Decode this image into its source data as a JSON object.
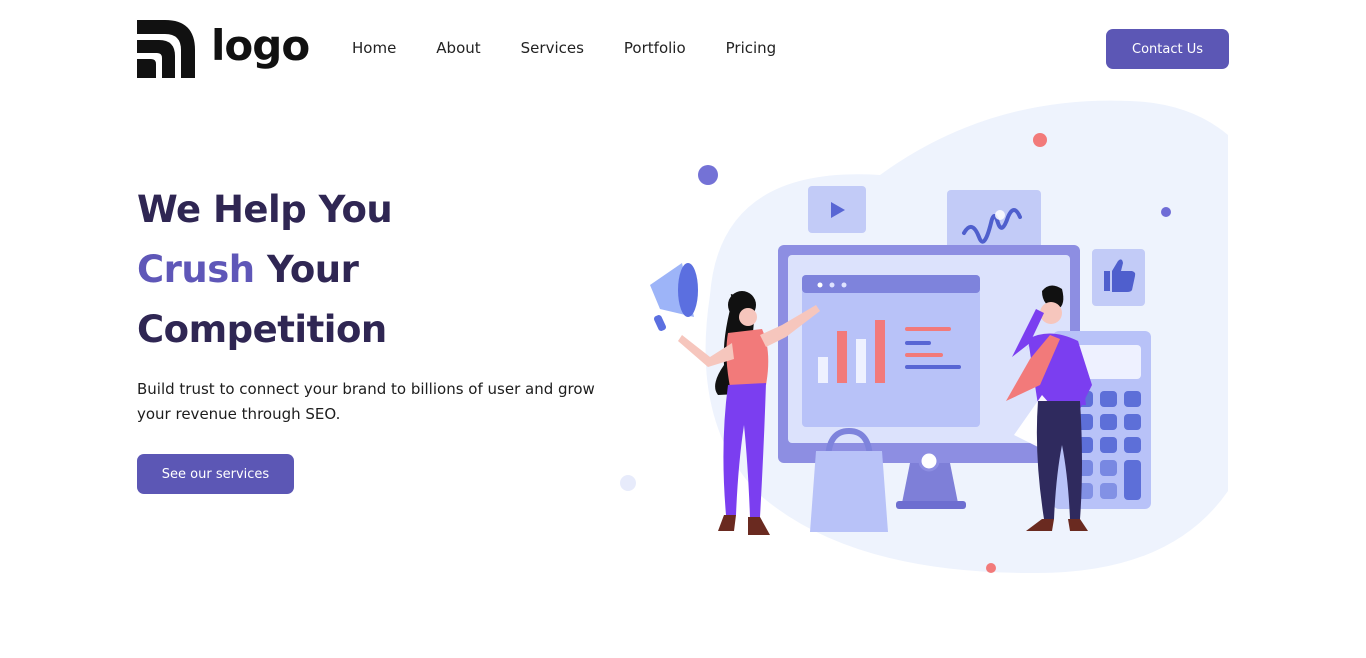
{
  "brand": {
    "logo_text": "logo"
  },
  "nav": {
    "items": [
      {
        "label": "Home"
      },
      {
        "label": "About"
      },
      {
        "label": "Services"
      },
      {
        "label": "Portfolio"
      },
      {
        "label": "Pricing"
      }
    ],
    "contact_label": "Contact Us"
  },
  "hero": {
    "title_line1": "We Help You",
    "title_line2_accent": "Crush",
    "title_line2_rest": " Your",
    "title_line3": "Competition",
    "subtitle": "Build trust to connect your brand to billions of user and grow your revenue through SEO.",
    "cta_label": "See our services"
  },
  "colors": {
    "primary": "#5c57b5",
    "heading": "#2f2653",
    "accent": "#5f57b8",
    "blob": "#eef3fd",
    "coral": "#f27a7a"
  }
}
